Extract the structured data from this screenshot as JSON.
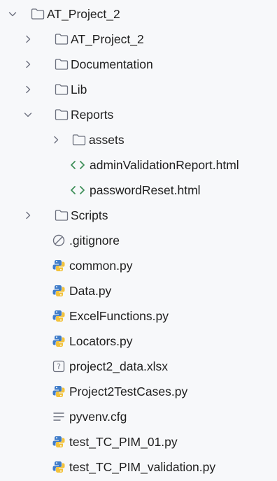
{
  "tree": {
    "rows": [
      {
        "label": "AT_Project_2",
        "type": "folder",
        "chevron": "chevron-down-icon",
        "icon": "folder-icon"
      },
      {
        "label": "AT_Project_2",
        "type": "folder",
        "chevron": "chevron-right-icon",
        "icon": "folder-icon"
      },
      {
        "label": "Documentation",
        "type": "folder",
        "chevron": "chevron-right-icon",
        "icon": "folder-icon"
      },
      {
        "label": "Lib",
        "type": "folder",
        "chevron": "chevron-right-icon",
        "icon": "folder-icon"
      },
      {
        "label": "Reports",
        "type": "folder",
        "chevron": "chevron-down-icon",
        "icon": "folder-icon"
      },
      {
        "label": "assets",
        "type": "folder",
        "chevron": "chevron-right-icon",
        "icon": "folder-icon"
      },
      {
        "label": "adminValidationReport.html",
        "type": "file",
        "icon": "html-file-icon"
      },
      {
        "label": "passwordReset.html",
        "type": "file",
        "icon": "html-file-icon"
      },
      {
        "label": "Scripts",
        "type": "folder",
        "chevron": "chevron-right-icon",
        "icon": "folder-icon"
      },
      {
        "label": ".gitignore",
        "type": "file",
        "icon": "ignored-file-icon"
      },
      {
        "label": "common.py",
        "type": "file",
        "icon": "python-file-icon"
      },
      {
        "label": "Data.py",
        "type": "file",
        "icon": "python-file-icon"
      },
      {
        "label": "ExcelFunctions.py",
        "type": "file",
        "icon": "python-file-icon"
      },
      {
        "label": "Locators.py",
        "type": "file",
        "icon": "python-file-icon"
      },
      {
        "label": "project2_data.xlsx",
        "type": "file",
        "icon": "unknown-file-icon"
      },
      {
        "label": "Project2TestCases.py",
        "type": "file",
        "icon": "python-file-icon"
      },
      {
        "label": "pyvenv.cfg",
        "type": "file",
        "icon": "config-file-icon"
      },
      {
        "label": "test_TC_PIM_01.py",
        "type": "file",
        "icon": "python-file-icon"
      },
      {
        "label": "test_TC_PIM_validation.py",
        "type": "file",
        "icon": "python-file-icon"
      }
    ]
  },
  "colors": {
    "background": "#f7f8fa",
    "text": "#1f1f1f",
    "icon_stroke": "#6c707e",
    "html_icon": "#3d8f58",
    "python_blue": "#3f7cc9",
    "python_yellow": "#f2c23c"
  }
}
